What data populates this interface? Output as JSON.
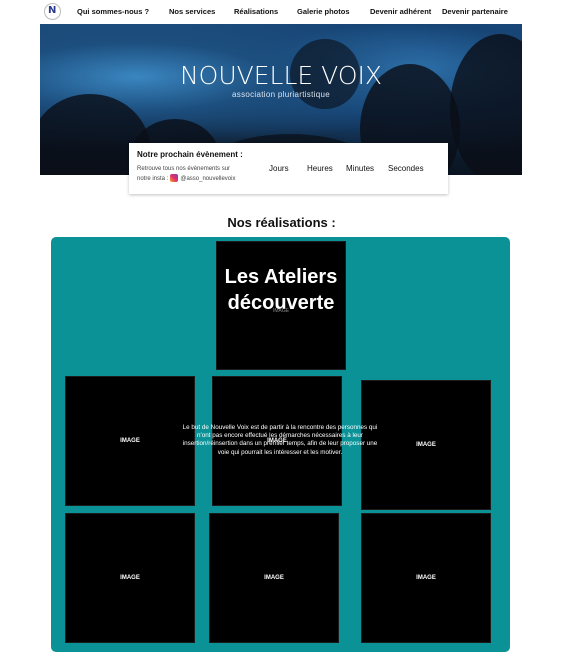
{
  "nav": {
    "logo_letter": "N",
    "items": [
      "Qui sommes-nous ?",
      "Nos services",
      "Réalisations",
      "Galerie photos",
      "Devenir adhérent",
      "Devenir partenaire"
    ]
  },
  "hero": {
    "title": "NOUVELLE VOIX",
    "subtitle": "association pluriartistique"
  },
  "event": {
    "title": "Notre prochain évènement :",
    "desc_line1": "Retrouve tous nos évènements sur",
    "desc_line2": "notre insta :",
    "insta_handle": "@asso_nouvellevoix",
    "countdown": [
      "Jours",
      "Heures",
      "Minutes",
      "Secondes"
    ]
  },
  "realisations": {
    "heading": "Nos réalisations :",
    "feature_title_1": "Les Ateliers",
    "feature_title_2": "découverte",
    "feature_image_label": "IMAGE",
    "tile_label": "IMAGE",
    "description": "Le but de Nouvelle Voix est de partir à la rencontre des personnes qui n'ont pas encore effectué les démarches nécessaires à leur insertion/réinsertion dans un premier temps, afin de leur proposer une voie qui pourrait les intéresser et les motiver."
  },
  "colors": {
    "panel": "#0a9297",
    "tile": "#000000"
  }
}
